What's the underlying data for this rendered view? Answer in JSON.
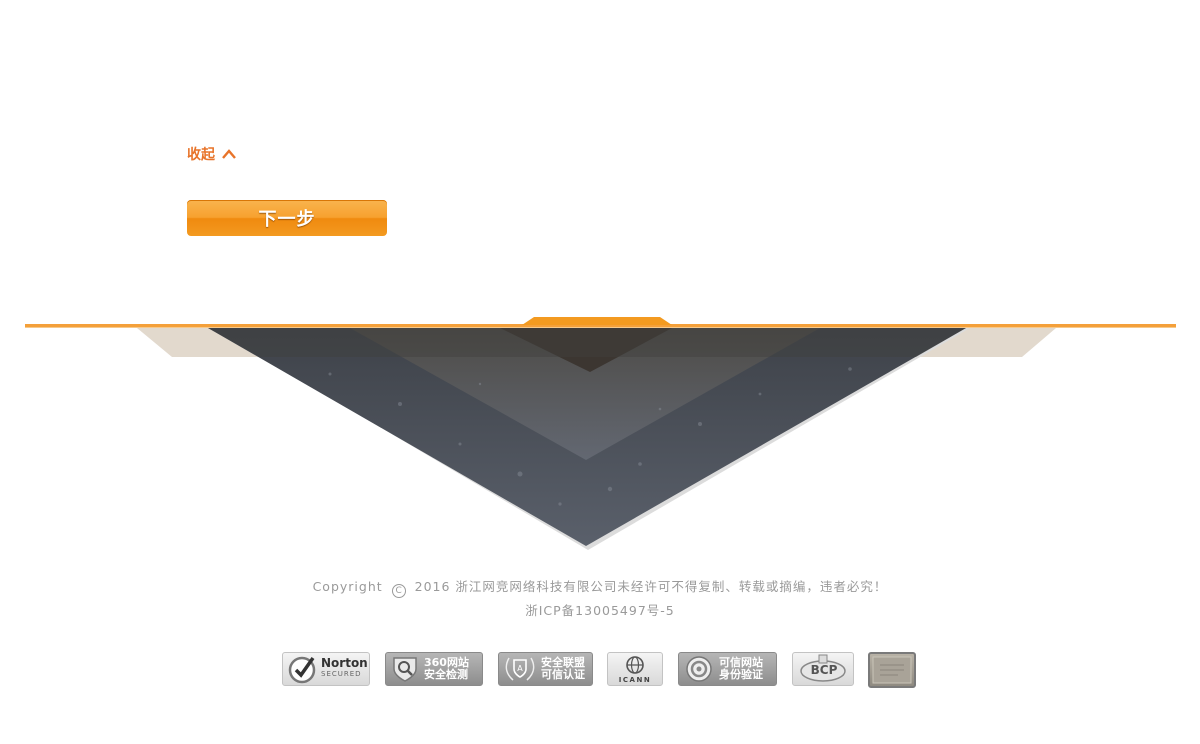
{
  "collapse": {
    "label": "收起"
  },
  "next_button": {
    "label": "下一步"
  },
  "footer": {
    "copyright_prefix": "Copyright",
    "copyright_symbol": "C",
    "copyright_rest": "2016 浙江网竞网络科技有限公司未经许可不得复制、转载或摘编，违者必究！",
    "icp": "浙ICP备13005497号-5"
  },
  "badges": {
    "norton": {
      "title": "Norton",
      "sub": "SECURED"
    },
    "site360": {
      "text": "360网站\n安全检测"
    },
    "alliance": {
      "text": "安全联盟\n可信认证"
    },
    "icann": {
      "text": "ICANN"
    },
    "trusted": {
      "text": "可信网站\n身份验证"
    },
    "bcp": {
      "text": "BCP"
    }
  },
  "colors": {
    "accent": "#f39a20",
    "link": "#e8742a",
    "footer_text": "#9a9a9a",
    "banner_dark": "#4a4f59",
    "banner_beige": "#e2d9cd"
  }
}
